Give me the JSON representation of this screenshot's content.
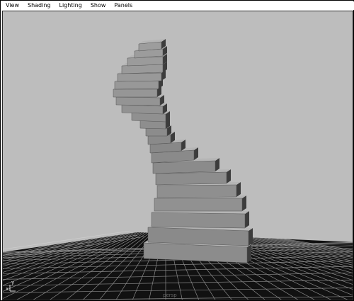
{
  "menubar": {
    "items": [
      {
        "label": "View"
      },
      {
        "label": "Shading"
      },
      {
        "label": "Lighting"
      },
      {
        "label": "Show"
      },
      {
        "label": "Panels"
      }
    ]
  },
  "viewport": {
    "background_color": "#bdbdbd",
    "ground_color": "#111111",
    "grid_color": "#8a8a8a",
    "object": "spiral-staircase",
    "axis_indicator": {
      "x": "x",
      "y": "y"
    },
    "camera_label": "persp"
  }
}
